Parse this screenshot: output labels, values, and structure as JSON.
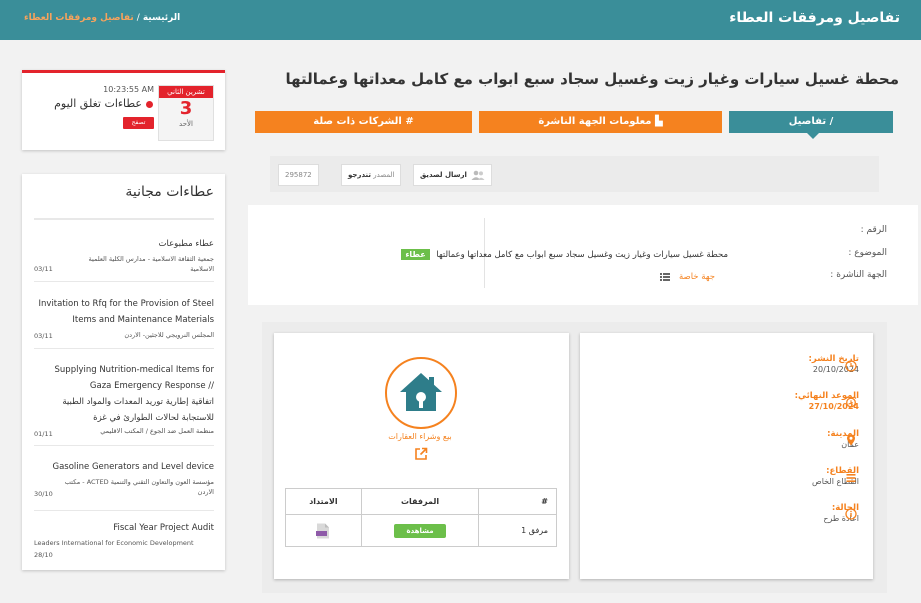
{
  "header": {
    "title": "تفاصيل ومرفقات العطاء",
    "breadcrumb": {
      "home": "الرئيسية",
      "sep": "/",
      "current": "تفاصيل ومرفقات العطاء"
    }
  },
  "tender": {
    "title": "محطة غسيل سيارات وغيار زيت وغسيل سجاد سبع ابواب مع كامل معداتها وعمالتها",
    "tabs": {
      "details": "/ تفاصيل",
      "publisher": "معلومات الجهة الناشرة",
      "related": "الشركات ذات صلة"
    },
    "actions": {
      "send": "ارسال لصديق",
      "source_label": "المصدر",
      "source_value": "تندرجو",
      "number": "295872"
    },
    "labels": {
      "number": "الرقم :",
      "subject": "الموضوع :",
      "entity": "الجهة الناشرة :"
    },
    "subject_badge": "عطاء",
    "subject_text": "محطة غسيل سيارات وغيار زيت وغسيل سجاد سبع ابواب مع كامل معداتها وعمالتها",
    "entity_value": "جهة خاصة",
    "meta": {
      "publish_label": "تاريخ النشر:",
      "publish_value": "20/10/2024",
      "deadline_label": "الموعد النهائي:",
      "deadline_value": "27/10/2024",
      "city_label": "المدينة:",
      "city_value": "عمان",
      "sector_label": "القطاع:",
      "sector_value": "القطاع الخاص",
      "status_label": "الحالة:",
      "status_value": "اعادة طرح"
    },
    "category": "بيع وشراء العقارات",
    "attachments": {
      "headers": {
        "num": "#",
        "files": "المرفقات",
        "ext": "الامتداد"
      },
      "rows": [
        {
          "name": "مرفق 1",
          "action": "مشاهدة"
        }
      ]
    }
  },
  "closing_today": {
    "month": "تشرين الثاني",
    "day": "3",
    "weekday": "الأحد",
    "time": "10:23:55 AM",
    "label": "عطاءات تغلق اليوم",
    "button": "تصفح"
  },
  "free_tenders": {
    "title": "عطاءات مجانية",
    "items": [
      {
        "title": "عطاء مطبوعات",
        "org": "جمعية الثقافة الاسلامية - مدارس الكلية العلمية الاسلامية",
        "date": "03/11"
      },
      {
        "title": "Invitation to Rfq for the Provision of Steel Items and Maintenance Materials",
        "org": "المجلس النرويجي للاجئين- الاردن",
        "date": "03/11"
      },
      {
        "title_en": "Supplying Nutrition-medical Items for Gaza Emergency Response //",
        "title_ar": "اتفاقية إطارية توريد المعدات والمواد الطبية للاستجابة لحالات الطوارئ في غزة",
        "org": "منظمة العمل ضد الجوع / المكتب الاقليمي",
        "date": "01/11"
      },
      {
        "title": "Gasoline Generators and Level device",
        "org": "مؤسسة العون والتعاون التقني والتنمية ACTED - مكتب الاردن",
        "date": "30/10"
      },
      {
        "title": "Fiscal Year Project Audit",
        "org": "Leaders International for Economic Development",
        "date": "28/10"
      }
    ]
  },
  "colors": {
    "teal": "#3a8e99",
    "orange": "#f5821f",
    "green": "#6cbf4a",
    "red": "#e3232c"
  }
}
